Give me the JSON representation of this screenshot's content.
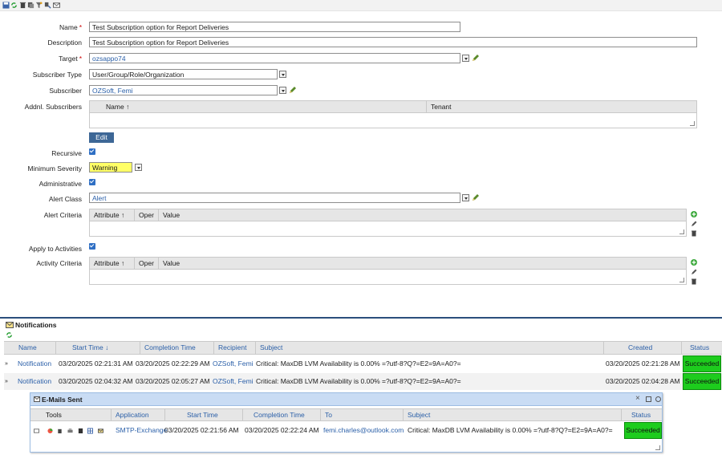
{
  "form": {
    "name_label": "Name",
    "name_value": "Test Subscription option for Report Deliveries",
    "description_label": "Description",
    "description_value": "Test Subscription option for Report Deliveries",
    "target_label": "Target",
    "target_value": "ozsappo74",
    "subscriber_type_label": "Subscriber Type",
    "subscriber_type_value": "User/Group/Role/Organization",
    "subscriber_label": "Subscriber",
    "subscriber_value": "OZSoft, Femi",
    "addnl_label": "Addnl. Subscribers",
    "addnl_columns": [
      "Name",
      "Tenant"
    ],
    "edit_button": "Edit",
    "recursive_label": "Recursive",
    "severity_label": "Minimum Severity",
    "severity_value": "Warning",
    "administrative_label": "Administrative",
    "alert_class_label": "Alert Class",
    "alert_class_value": "Alert",
    "alert_criteria_label": "Alert Criteria",
    "criteria_columns": [
      "Attribute",
      "Oper",
      "Value"
    ],
    "apply_label": "Apply to Activities",
    "activity_criteria_label": "Activity Criteria",
    "required_mark": "*"
  },
  "notifications": {
    "title": "Notifications",
    "columns": [
      "Name",
      "Start Time",
      "Completion Time",
      "Recipient",
      "Subject",
      "Created",
      "Status"
    ],
    "rows": [
      {
        "name": "Notification",
        "start": "03/20/2025 02:21:31 AM",
        "completion": "03/20/2025 02:22:29 AM",
        "recipient": "OZSoft, Femi",
        "subject": "Critical: MaxDB LVM Availability is 0.00% =?utf-8?Q?=E2=9A=A0?=",
        "created": "03/20/2025 02:21:28 AM",
        "status": "Succeeded"
      },
      {
        "name": "Notification",
        "start": "03/20/2025 02:04:32 AM",
        "completion": "03/20/2025 02:05:27 AM",
        "recipient": "OZSoft, Femi",
        "subject": "Critical: MaxDB LVM Availability is 0.00% =?utf-8?Q?=E2=9A=A0?=",
        "created": "03/20/2025 02:04:28 AM",
        "status": "Succeeded"
      }
    ]
  },
  "emails": {
    "title": "E-Mails Sent",
    "columns": [
      "Tools",
      "Application",
      "Start Time",
      "Completion Time",
      "To",
      "Subject",
      "Status"
    ],
    "rows": [
      {
        "application": "SMTP-Exchange",
        "start": "03/20/2025 02:21:56 AM",
        "completion": "03/20/2025 02:22:24 AM",
        "to": "femi.charles@outlook.com",
        "subject": "Critical: MaxDB LVM Availability is 0.00% =?utf-8?Q?=E2=9A=A0?=",
        "status": "Succeeded"
      }
    ]
  },
  "colors": {
    "accent": "#2a5fa8",
    "success": "#1dcc1d",
    "warning_field": "#ffff66",
    "edit_button": "#3d6796"
  }
}
